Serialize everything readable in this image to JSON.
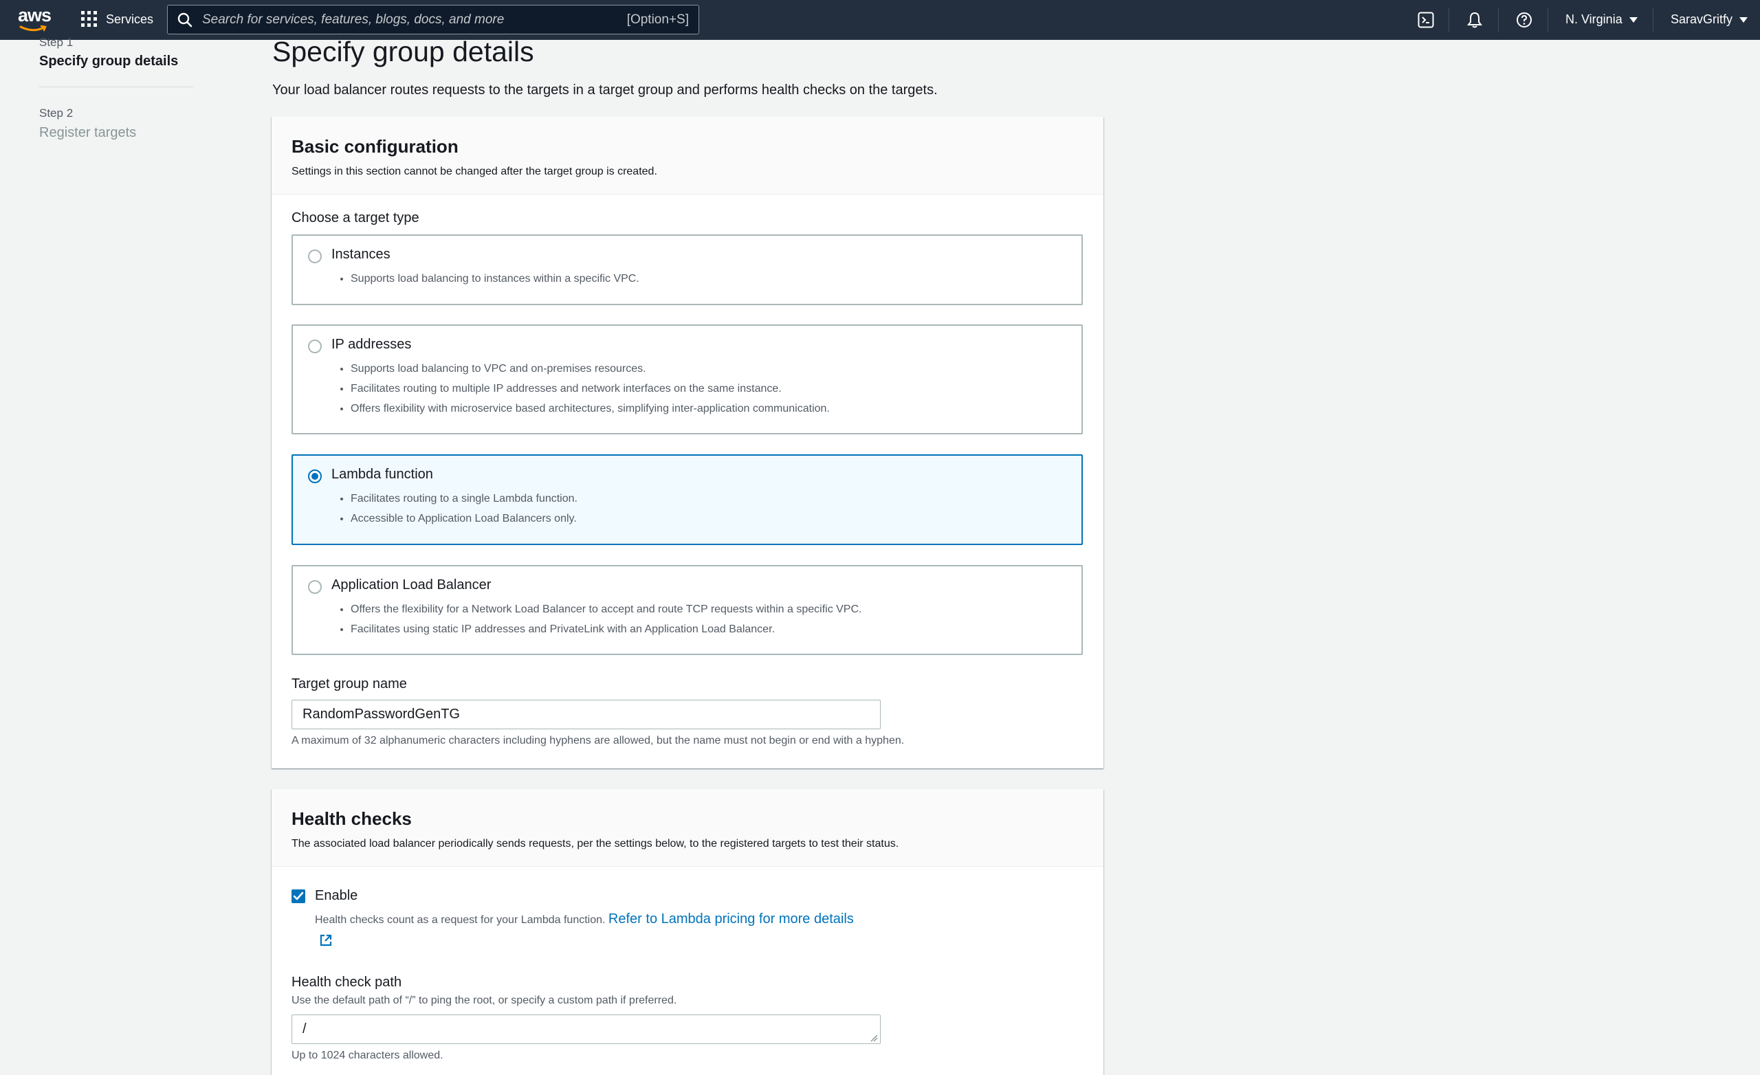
{
  "nav": {
    "logo": "aws",
    "services_label": "Services",
    "search_placeholder": "Search for services, features, blogs, docs, and more",
    "search_shortcut": "[Option+S]",
    "region": "N. Virginia",
    "account": "SaravGritfy",
    "icons": [
      "grid-icon",
      "search-icon",
      "cloudshell-icon",
      "bell-icon",
      "help-icon",
      "caret-down-icon"
    ]
  },
  "steps": {
    "step1_label": "Step 1",
    "step1_title": "Specify group details",
    "step2_label": "Step 2",
    "step2_title": "Register targets"
  },
  "page": {
    "title": "Specify group details",
    "description": "Your load balancer routes requests to the targets in a target group and performs health checks on the targets."
  },
  "basic": {
    "title": "Basic configuration",
    "subtitle": "Settings in this section cannot be changed after the target group is created.",
    "target_type_label": "Choose a target type",
    "options": [
      {
        "title": "Instances",
        "bullets": [
          "Supports load balancing to instances within a specific VPC."
        ],
        "selected": false
      },
      {
        "title": "IP addresses",
        "bullets": [
          "Supports load balancing to VPC and on-premises resources.",
          "Facilitates routing to multiple IP addresses and network interfaces on the same instance.",
          "Offers flexibility with microservice based architectures, simplifying inter-application communication."
        ],
        "selected": false
      },
      {
        "title": "Lambda function",
        "bullets": [
          "Facilitates routing to a single Lambda function.",
          "Accessible to Application Load Balancers only."
        ],
        "selected": true
      },
      {
        "title": "Application Load Balancer",
        "bullets": [
          "Offers the flexibility for a Network Load Balancer to accept and route TCP requests within a specific VPC.",
          "Facilitates using static IP addresses and PrivateLink with an Application Load Balancer."
        ],
        "selected": false
      }
    ],
    "name_label": "Target group name",
    "name_value": "RandomPasswordGenTG",
    "name_hint": "A maximum of 32 alphanumeric characters including hyphens are allowed, but the name must not begin or end with a hyphen."
  },
  "health": {
    "title": "Health checks",
    "subtitle": "The associated load balancer periodically sends requests, per the settings below, to the registered targets to test their status.",
    "enable_label": "Enable",
    "enable_checked": true,
    "enable_desc": "Health checks count as a request for your Lambda function.",
    "pricing_link": "Refer to Lambda pricing for more details",
    "path_label": "Health check path",
    "path_desc": "Use the default path of “/” to ping the root, or specify a custom path if preferred.",
    "path_value": "/",
    "path_hint": "Up to 1024 characters allowed."
  },
  "colors": {
    "nav_bg": "#232f3e",
    "accent": "#0073bb",
    "page_bg": "#f2f3f3",
    "selected_tile_bg": "#f1faff"
  }
}
